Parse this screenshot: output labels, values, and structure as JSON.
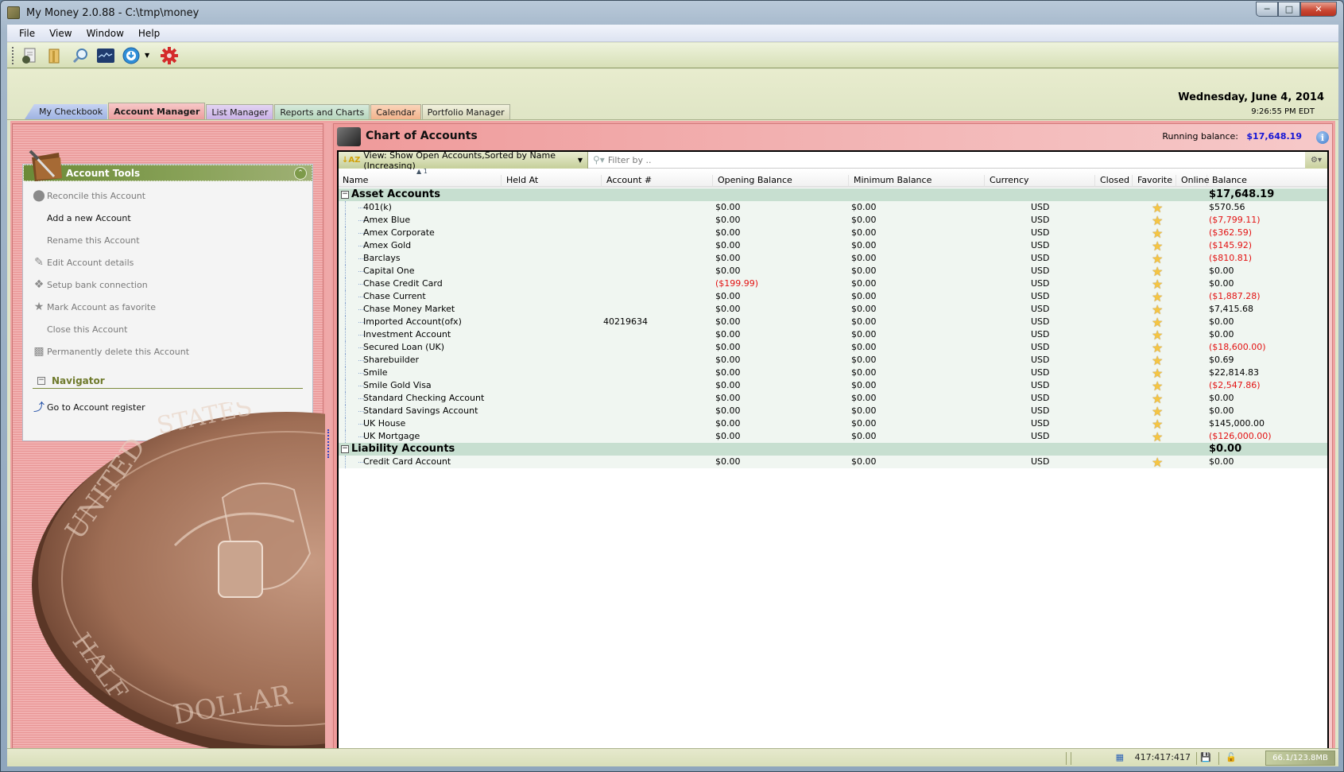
{
  "window": {
    "title": "My Money 2.0.88  - C:\\tmp\\money",
    "controls": [
      "minimize",
      "maximize",
      "close"
    ]
  },
  "menu": [
    "File",
    "View",
    "Window",
    "Help"
  ],
  "toolbar": {
    "buttons": [
      "new-file-icon",
      "open-folder-icon",
      "search-icon",
      "chart-icon",
      "download-icon",
      "settings-gear-icon"
    ]
  },
  "tabs": [
    {
      "label": "My Checkbook",
      "active": false
    },
    {
      "label": "Account Manager",
      "active": true
    },
    {
      "label": "List Manager",
      "active": false
    },
    {
      "label": "Reports and Charts",
      "active": false
    },
    {
      "label": "Calendar",
      "active": false
    },
    {
      "label": "Portfolio Manager",
      "active": false
    }
  ],
  "datetime": {
    "date": "Wednesday, June 4, 2014",
    "time": "9:26:55 PM EDT"
  },
  "left_panel": {
    "tools_title": "Account Tools",
    "tools": [
      {
        "label": "Reconcile this Account",
        "icon": "reconcile-icon",
        "enabled": false
      },
      {
        "label": "Add a new Account",
        "icon": "",
        "enabled": true
      },
      {
        "label": "Rename this Account",
        "icon": "",
        "enabled": false
      },
      {
        "label": "Edit Account details",
        "icon": "edit-icon",
        "enabled": false
      },
      {
        "label": "Setup bank connection",
        "icon": "antenna-icon",
        "enabled": false
      },
      {
        "label": "Mark Account as favorite",
        "icon": "star-icon",
        "enabled": false
      },
      {
        "label": "Close this Account",
        "icon": "",
        "enabled": false
      },
      {
        "label": "Permanently delete this Account",
        "icon": "trash-icon",
        "enabled": false
      }
    ],
    "navigator_title": "Navigator",
    "navigator_items": [
      {
        "label": "Go to Account register",
        "icon": "go-arrow-icon"
      }
    ]
  },
  "main": {
    "title": "Chart of Accounts",
    "running_balance_label": "Running balance:",
    "running_balance_value": "$17,648.19",
    "view_label": "View: Show Open Accounts,Sorted by Name (Increasing)",
    "filter_placeholder": "Filter by ..",
    "sort_indicator": "1",
    "columns": [
      "Name",
      "Held At",
      "Account #",
      "Opening Balance",
      "Minimum Balance",
      "Currency",
      "Closed",
      "Favorite",
      "Online",
      "Balance"
    ],
    "groups": [
      {
        "name": "Asset Accounts",
        "balance": "$17,648.19",
        "accounts": [
          {
            "name": "401(k)",
            "held_at": "",
            "account_no": "",
            "opening": "$0.00",
            "minimum": "$0.00",
            "currency": "USD",
            "favorite": true,
            "balance": "$570.56",
            "negative": false,
            "opening_negative": false
          },
          {
            "name": "Amex Blue",
            "held_at": "",
            "account_no": "",
            "opening": "$0.00",
            "minimum": "$0.00",
            "currency": "USD",
            "favorite": true,
            "balance": "($7,799.11)",
            "negative": true,
            "opening_negative": false
          },
          {
            "name": "Amex Corporate",
            "held_at": "",
            "account_no": "",
            "opening": "$0.00",
            "minimum": "$0.00",
            "currency": "USD",
            "favorite": true,
            "balance": "($362.59)",
            "negative": true,
            "opening_negative": false
          },
          {
            "name": "Amex Gold",
            "held_at": "",
            "account_no": "",
            "opening": "$0.00",
            "minimum": "$0.00",
            "currency": "USD",
            "favorite": true,
            "balance": "($145.92)",
            "negative": true,
            "opening_negative": false
          },
          {
            "name": "Barclays",
            "held_at": "",
            "account_no": "",
            "opening": "$0.00",
            "minimum": "$0.00",
            "currency": "USD",
            "favorite": true,
            "balance": "($810.81)",
            "negative": true,
            "opening_negative": false
          },
          {
            "name": "Capital One",
            "held_at": "",
            "account_no": "",
            "opening": "$0.00",
            "minimum": "$0.00",
            "currency": "USD",
            "favorite": true,
            "balance": "$0.00",
            "negative": false,
            "opening_negative": false
          },
          {
            "name": "Chase Credit Card",
            "held_at": "",
            "account_no": "",
            "opening": "($199.99)",
            "minimum": "$0.00",
            "currency": "USD",
            "favorite": true,
            "balance": "$0.00",
            "negative": false,
            "opening_negative": true
          },
          {
            "name": "Chase Current",
            "held_at": "",
            "account_no": "",
            "opening": "$0.00",
            "minimum": "$0.00",
            "currency": "USD",
            "favorite": true,
            "balance": "($1,887.28)",
            "negative": true,
            "opening_negative": false
          },
          {
            "name": "Chase Money Market",
            "held_at": "",
            "account_no": "",
            "opening": "$0.00",
            "minimum": "$0.00",
            "currency": "USD",
            "favorite": true,
            "balance": "$7,415.68",
            "negative": false,
            "opening_negative": false
          },
          {
            "name": "Imported Account(ofx)",
            "held_at": "",
            "account_no": "40219634",
            "opening": "$0.00",
            "minimum": "$0.00",
            "currency": "USD",
            "favorite": true,
            "balance": "$0.00",
            "negative": false,
            "opening_negative": false
          },
          {
            "name": "Investment Account",
            "held_at": "",
            "account_no": "",
            "opening": "$0.00",
            "minimum": "$0.00",
            "currency": "USD",
            "favorite": true,
            "balance": "$0.00",
            "negative": false,
            "opening_negative": false
          },
          {
            "name": "Secured Loan (UK)",
            "held_at": "",
            "account_no": "",
            "opening": "$0.00",
            "minimum": "$0.00",
            "currency": "USD",
            "favorite": true,
            "balance": "($18,600.00)",
            "negative": true,
            "opening_negative": false
          },
          {
            "name": "Sharebuilder",
            "held_at": "",
            "account_no": "",
            "opening": "$0.00",
            "minimum": "$0.00",
            "currency": "USD",
            "favorite": true,
            "balance": "$0.69",
            "negative": false,
            "opening_negative": false
          },
          {
            "name": "Smile",
            "held_at": "",
            "account_no": "",
            "opening": "$0.00",
            "minimum": "$0.00",
            "currency": "USD",
            "favorite": true,
            "balance": "$22,814.83",
            "negative": false,
            "opening_negative": false
          },
          {
            "name": "Smile Gold Visa",
            "held_at": "",
            "account_no": "",
            "opening": "$0.00",
            "minimum": "$0.00",
            "currency": "USD",
            "favorite": true,
            "balance": "($2,547.86)",
            "negative": true,
            "opening_negative": false
          },
          {
            "name": "Standard Checking Account",
            "held_at": "",
            "account_no": "",
            "opening": "$0.00",
            "minimum": "$0.00",
            "currency": "USD",
            "favorite": true,
            "balance": "$0.00",
            "negative": false,
            "opening_negative": false
          },
          {
            "name": "Standard Savings Account",
            "held_at": "",
            "account_no": "",
            "opening": "$0.00",
            "minimum": "$0.00",
            "currency": "USD",
            "favorite": true,
            "balance": "$0.00",
            "negative": false,
            "opening_negative": false
          },
          {
            "name": "UK House",
            "held_at": "",
            "account_no": "",
            "opening": "$0.00",
            "minimum": "$0.00",
            "currency": "USD",
            "favorite": true,
            "balance": "$145,000.00",
            "negative": false,
            "opening_negative": false
          },
          {
            "name": "UK Mortgage",
            "held_at": "",
            "account_no": "",
            "opening": "$0.00",
            "minimum": "$0.00",
            "currency": "USD",
            "favorite": true,
            "balance": "($126,000.00)",
            "negative": true,
            "opening_negative": false
          }
        ]
      },
      {
        "name": "Liability Accounts",
        "balance": "$0.00",
        "accounts": [
          {
            "name": "Credit Card Account",
            "held_at": "",
            "account_no": "",
            "opening": "$0.00",
            "minimum": "$0.00",
            "currency": "USD",
            "favorite": true,
            "balance": "$0.00",
            "negative": false,
            "opening_negative": false
          }
        ]
      }
    ]
  },
  "statusbar": {
    "counter": "417:417:417",
    "memory": "66.1/123.8MB"
  },
  "colors": {
    "negative": "#e31212",
    "running_balance": "#1515d6",
    "group_row": "#c7dfd0",
    "account_row": "#f0f6f1",
    "panel_pink": "#efa3a3"
  }
}
